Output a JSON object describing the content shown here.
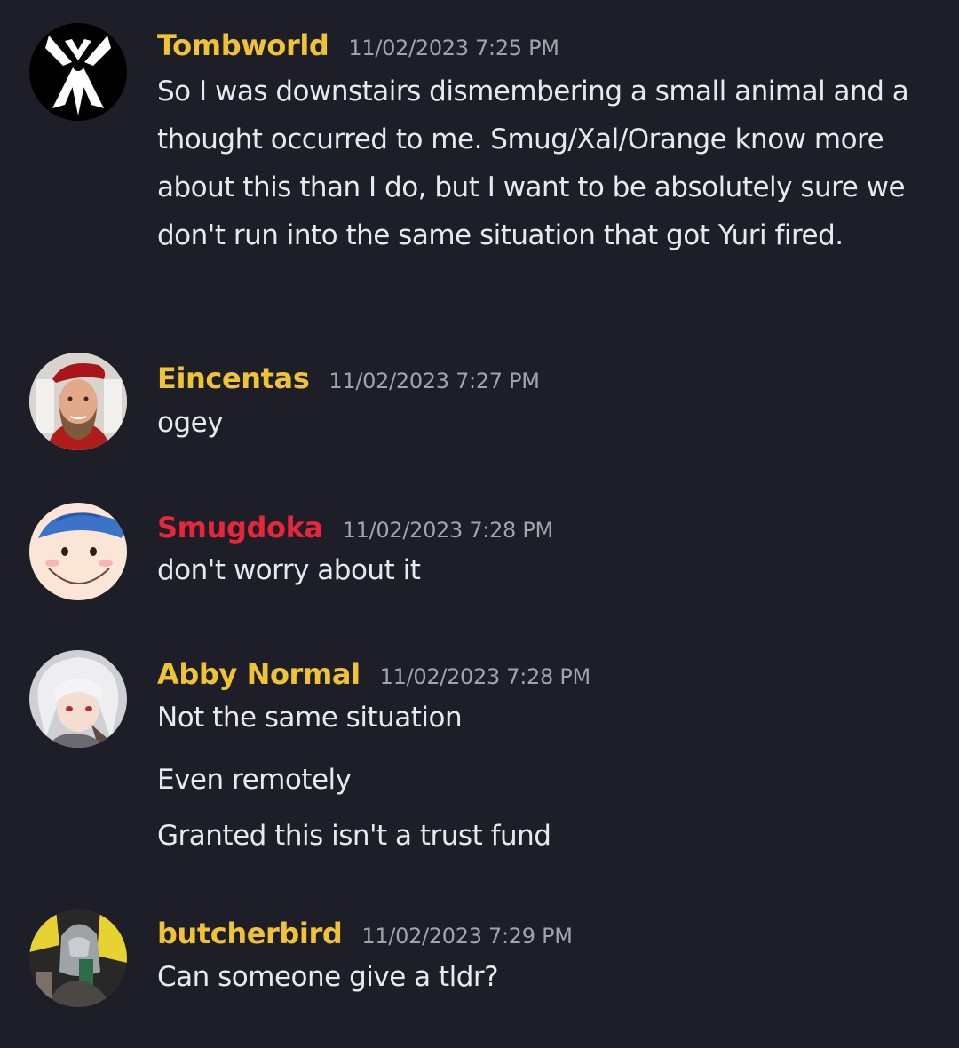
{
  "messages": [
    {
      "username": "Tombworld",
      "username_color": "#f0c337",
      "timestamp": "11/02/2023 7:25 PM",
      "avatar_icon": "white-ribbon-symbol-avatar",
      "lines": [
        "So I was downstairs dismembering a small animal and a thought occurred to me. Smug/Xal/Orange know more about this than I do, but I want to be absolutely sure we don't run into the same situation that got Yuri fired."
      ]
    },
    {
      "username": "Eincentas",
      "username_color": "#f0c337",
      "timestamp": "11/02/2023 7:27 PM",
      "avatar_icon": "bearded-man-red-beret-avatar",
      "lines": [
        "ogey"
      ]
    },
    {
      "username": "Smugdoka",
      "username_color": "#e8263a",
      "timestamp": "11/02/2023 7:28 PM",
      "avatar_icon": "smug-anime-face-avatar",
      "lines": [
        "don't worry about it"
      ]
    },
    {
      "username": "Abby Normal",
      "username_color": "#f0c337",
      "timestamp": "11/02/2023 7:28 PM",
      "avatar_icon": "white-haired-anime-girl-avatar",
      "lines": [
        "Not the same situation",
        "Even remotely",
        "Granted this isn't a trust fund"
      ]
    },
    {
      "username": "butcherbird",
      "username_color": "#f0c337",
      "timestamp": "11/02/2023 7:29 PM",
      "avatar_icon": "armored-figure-comic-avatar",
      "lines": [
        "Can someone give a tldr?"
      ]
    }
  ],
  "colors": {
    "background": "#1d1e27",
    "timestamp": "#a2a4ab",
    "message_text": "#e8e9ec"
  }
}
